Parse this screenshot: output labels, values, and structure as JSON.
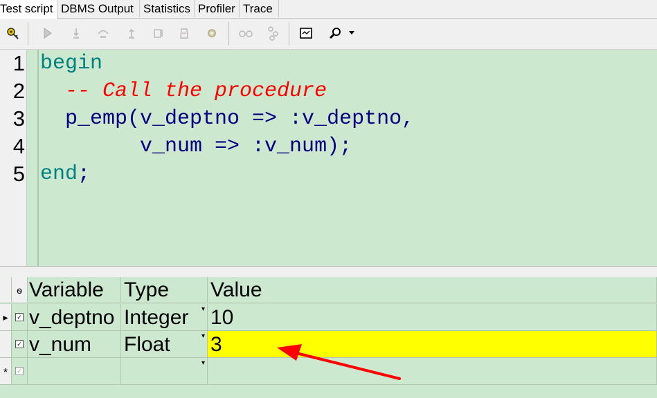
{
  "tabs": [
    "Test script",
    "DBMS Output",
    "Statistics",
    "Profiler",
    "Trace"
  ],
  "toolbar": {
    "icons": [
      "key-icon",
      "execute-icon",
      "step-into-icon",
      "step-over-icon",
      "step-out-icon",
      "run-to-exception-icon",
      "stop-icon",
      "settings-icon",
      "watch-icon",
      "breakpoint-icon",
      "output-window-icon",
      "find-icon",
      "dropdown-arrow-icon"
    ]
  },
  "editor": {
    "line_numbers": [
      "1",
      "2",
      "3",
      "4",
      "5"
    ],
    "lines": [
      [
        {
          "t": "begin",
          "c": "kw"
        }
      ],
      [
        {
          "t": "  -- Call the procedure",
          "c": "cm"
        }
      ],
      [
        {
          "t": "  p_emp(v_deptno => :v_deptno,",
          "c": "id"
        }
      ],
      [
        {
          "t": "        v_num => :v_num);",
          "c": "id"
        }
      ],
      [
        {
          "t": "end",
          "c": "kw"
        },
        {
          "t": ";",
          "c": "id"
        }
      ]
    ]
  },
  "grid": {
    "header_marker": "ѳ",
    "columns": [
      "Variable",
      "Type",
      "Value"
    ],
    "rows": [
      {
        "indicator": "▸",
        "checked": "☑",
        "variable": "v_deptno",
        "type": "Integer",
        "value": "10"
      },
      {
        "indicator": "",
        "checked": "☑",
        "variable": "v_num",
        "type": "Float",
        "value": "3"
      },
      {
        "indicator": "*",
        "checked": "☑",
        "variable": "",
        "type": "",
        "value": ""
      }
    ]
  },
  "colors": {
    "editor_bg": "#cce8cf",
    "keyword": "#008080",
    "comment": "#ff0000",
    "identifier": "#000080",
    "highlight": "#ffff00",
    "arrow": "#ff0000"
  }
}
